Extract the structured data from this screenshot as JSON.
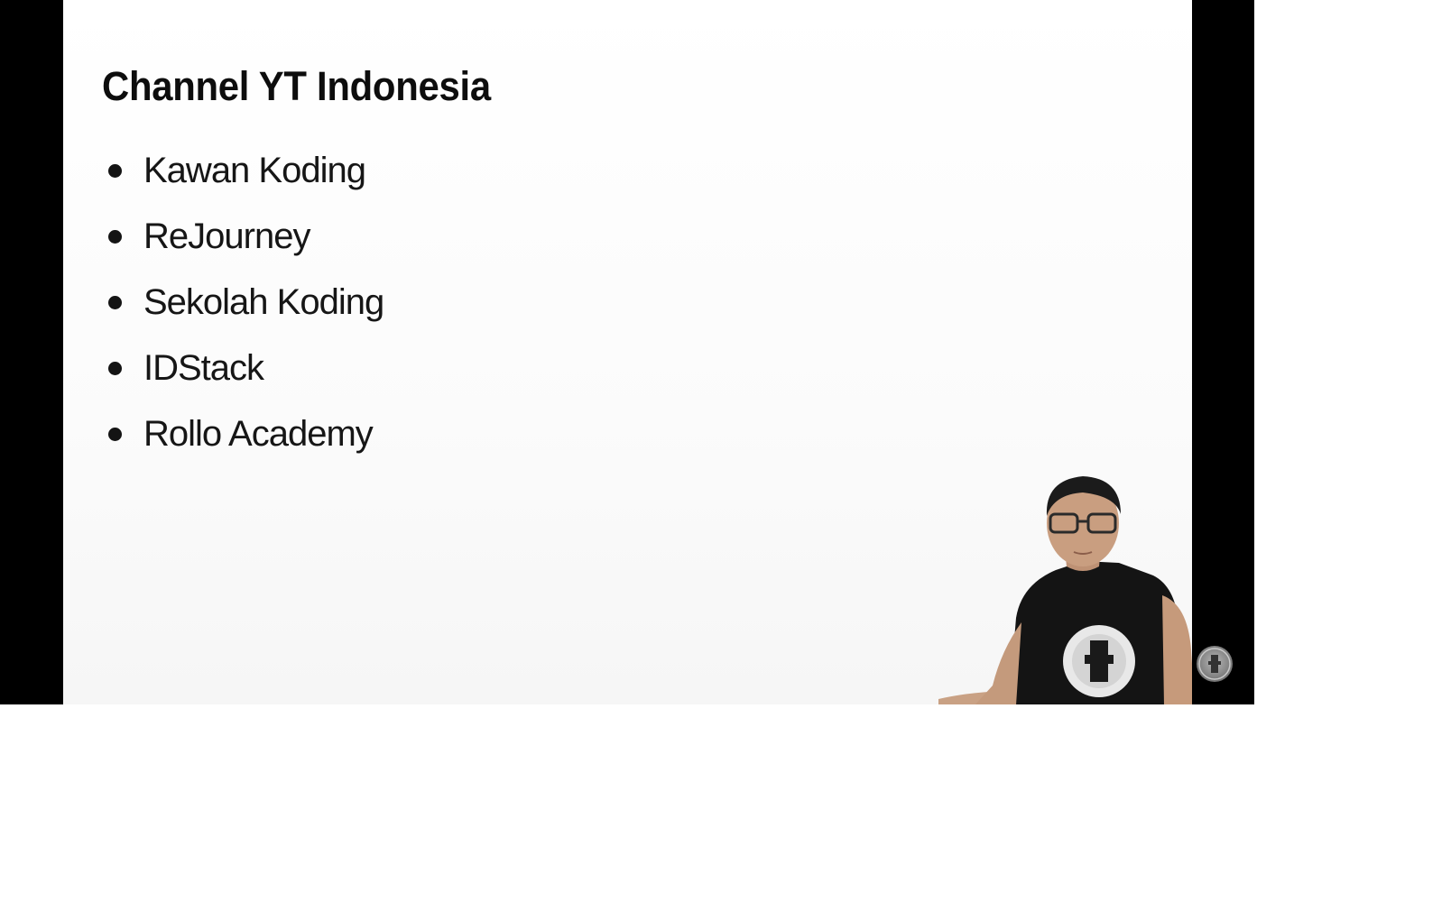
{
  "slide": {
    "title": "Channel YT Indonesia",
    "items": [
      "Kawan Koding",
      "ReJourney",
      "Sekolah Koding",
      "IDStack",
      "Rollo Academy"
    ]
  },
  "icons": {
    "watermark": "channel-watermark-icon",
    "presenter": "presenter-webcam"
  },
  "colors": {
    "letterbox": "#000000",
    "slide_background": "#ffffff",
    "text": "#111111"
  }
}
